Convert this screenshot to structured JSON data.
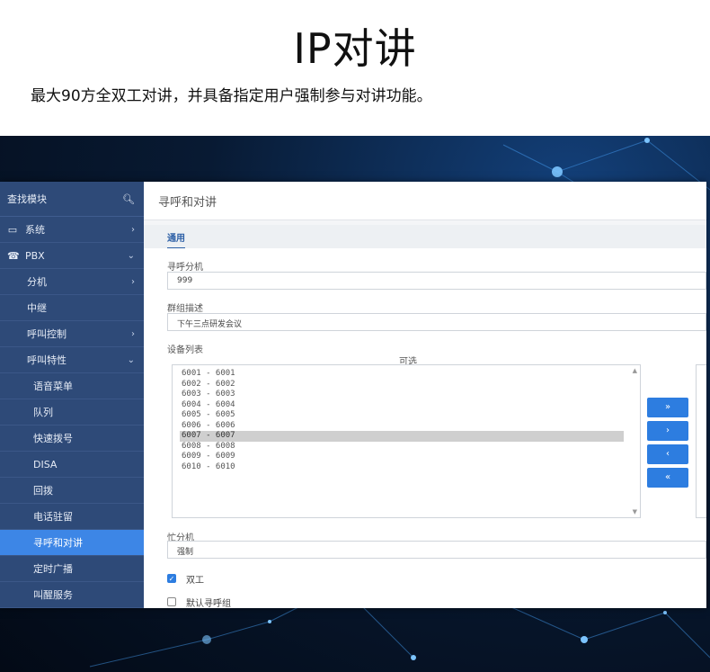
{
  "hero": {
    "title": "IP对讲",
    "subtitle": "最大90方全双工对讲，并具备指定用户强制参与对讲功能。"
  },
  "sidebar": {
    "search_label": "查找模块",
    "items": [
      {
        "label": "系统",
        "icon": "monitor-icon",
        "chevron": "›"
      },
      {
        "label": "PBX",
        "icon": "phone-icon",
        "chevron": "⌄"
      },
      {
        "label": "分机",
        "chevron": "›"
      },
      {
        "label": "中继",
        "chevron": ""
      },
      {
        "label": "呼叫控制",
        "chevron": "›"
      },
      {
        "label": "呼叫特性",
        "chevron": "⌄"
      },
      {
        "label": "语音菜单"
      },
      {
        "label": "队列"
      },
      {
        "label": "快速拨号"
      },
      {
        "label": "DISA"
      },
      {
        "label": "回拨"
      },
      {
        "label": "电话驻留"
      },
      {
        "label": "寻呼和对讲",
        "active": true
      },
      {
        "label": "定时广播"
      },
      {
        "label": "叫醒服务"
      }
    ]
  },
  "main": {
    "title": "寻呼和对讲",
    "tab": "通用",
    "paging_ext_label": "寻呼分机",
    "paging_ext_value": "999",
    "group_desc_label": "群组描述",
    "group_desc_value": "下午三点研发会议",
    "device_list_label": "设备列表",
    "available_label": "可选",
    "devices": [
      "6001 - 6001",
      "6002 - 6002",
      "6003 - 6003",
      "6004 - 6004",
      "6005 - 6005",
      "6006 - 6006",
      "6007 - 6007",
      "6008 - 6008",
      "6009 - 6009",
      "6010 - 6010"
    ],
    "selected_index": 6,
    "move_buttons": [
      "»",
      "›",
      "‹",
      "«"
    ],
    "busy_ext_label": "忙分机",
    "busy_ext_value": "强制",
    "duplex_label": "双工",
    "duplex_checked": true,
    "default_group_label": "默认寻呼组",
    "default_group_checked": false
  },
  "colors": {
    "sidebar": "#2e4a78",
    "active": "#3d86e6",
    "accent": "#2d7de0"
  }
}
